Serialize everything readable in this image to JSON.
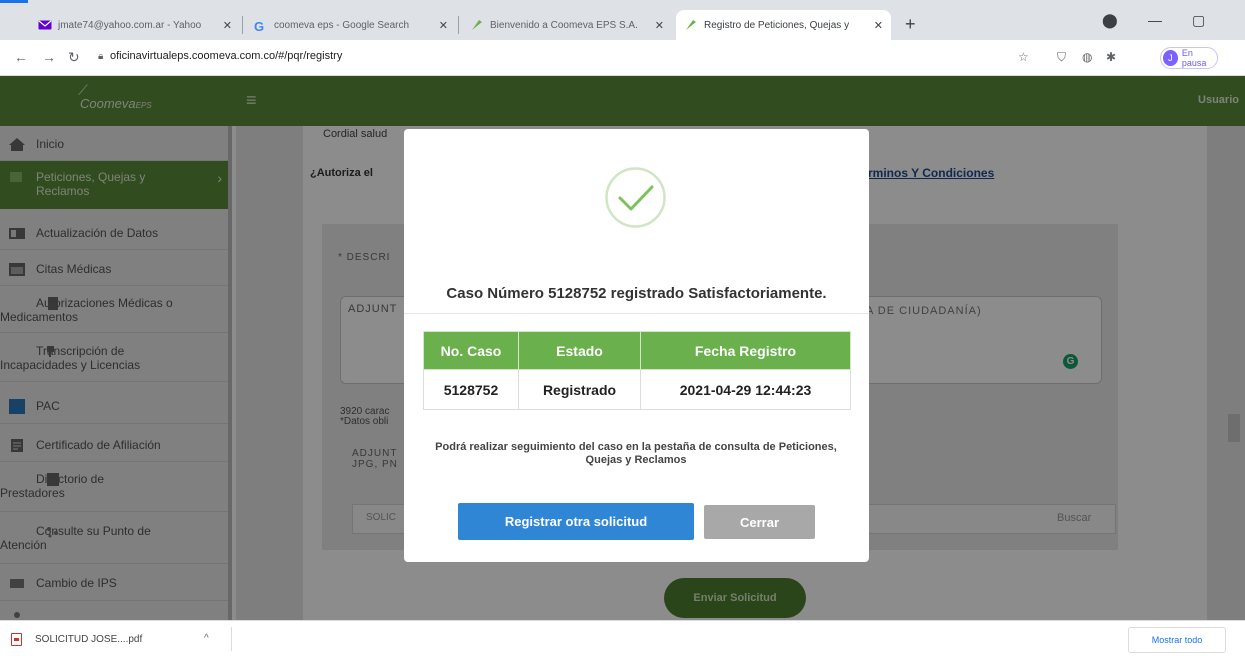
{
  "browser": {
    "tabs": [
      {
        "title": "jmate74@yahoo.com.ar - Yahoo",
        "active": false
      },
      {
        "title": "coomeva eps - Google Search",
        "active": false
      },
      {
        "title": "Bienvenido a Coomeva EPS S.A.",
        "active": false
      },
      {
        "title": "Registro de Peticiones, Quejas y",
        "active": true
      }
    ],
    "url": "oficinavirtualeps.coomeva.com.co/#/pqr/registry",
    "profile_label": "En pausa",
    "profile_initial": "J",
    "colors": {
      "tab_bar": "#dee1e6",
      "accent": "#1a73e8"
    }
  },
  "app": {
    "logo": "Coomeva",
    "logo_suffix": "EPS",
    "user_label": "Usuario",
    "colors": {
      "header": "#5a8a3a",
      "sidebar_active": "#5a8a3a",
      "modal_table_header": "#6ab04c",
      "primary_button": "#2f86d5",
      "secondary_button": "#a8a8a8"
    }
  },
  "sidebar": {
    "items": [
      {
        "label": "Inicio",
        "icon": "home-icon"
      },
      {
        "label": "Peticiones, Quejas y Reclamos",
        "icon": "pqr-icon",
        "active": true
      },
      {
        "label": "Actualización de Datos",
        "icon": "id-card-icon"
      },
      {
        "label": "Citas Médicas",
        "icon": "calendar-icon"
      },
      {
        "label": "Autorizaciones Médicas o Medicamentos",
        "icon": "building-icon"
      },
      {
        "label": "Transcripción de Incapacidades y Licencias",
        "icon": "transcription-icon"
      },
      {
        "label": "PAC",
        "icon": "pac-icon"
      },
      {
        "label": "Certificado de Afiliación",
        "icon": "certificate-icon"
      },
      {
        "label": "Directorio de Prestadores",
        "icon": "directory-icon"
      },
      {
        "label": "Consulte su Punto de Atención",
        "icon": "location-icon"
      },
      {
        "label": "Cambio de IPS",
        "icon": "swap-icon"
      }
    ]
  },
  "background_form": {
    "greeting": "Cordial salud",
    "authorize_question": "¿Autoriza el",
    "terms_link": "rminos Y Condiciones",
    "description_label": "* DESCRI",
    "textarea_left": "ADJUNT",
    "textarea_right": "A DE CIUDADANÍA)",
    "char_count_line1": "3920 carac",
    "char_count_line2": "*Datos obli",
    "attach_line1": "ADJUNT",
    "attach_line2": "JPG, PN",
    "file_field_left": "SOLIC",
    "file_search_button": "Buscar",
    "submit_button": "Enviar Solicitud"
  },
  "modal": {
    "message": "Caso Número 5128752 registrado Satisfactoriamente.",
    "table": {
      "headers": [
        "No. Caso",
        "Estado",
        "Fecha Registro"
      ],
      "rows": [
        [
          "5128752",
          "Registrado",
          "2021-04-29 12:44:23"
        ]
      ]
    },
    "note": "Podrá realizar seguimiento del caso en la pestaña de consulta de Peticiones, Quejas y Reclamos",
    "primary_button": "Registrar otra solicitud",
    "secondary_button": "Cerrar"
  },
  "downloads": {
    "file_name": "SOLICITUD JOSE....pdf",
    "show_all": "Mostrar todo"
  }
}
